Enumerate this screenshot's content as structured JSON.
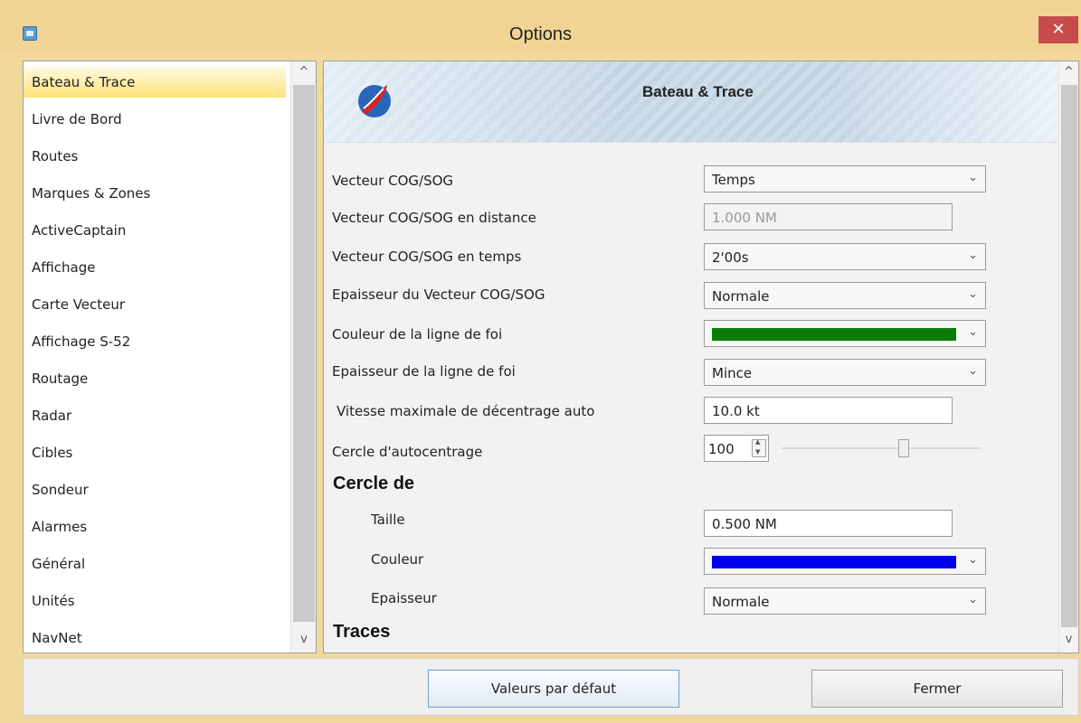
{
  "window": {
    "title": "Options",
    "close_label": "✕"
  },
  "sidebar": {
    "items": [
      {
        "label": "Bateau & Trace",
        "active": true
      },
      {
        "label": "Livre de Bord"
      },
      {
        "label": "Routes"
      },
      {
        "label": "Marques & Zones"
      },
      {
        "label": "ActiveCaptain"
      },
      {
        "label": "Affichage"
      },
      {
        "label": "Carte Vecteur"
      },
      {
        "label": "Affichage S-52"
      },
      {
        "label": "Routage"
      },
      {
        "label": "Radar"
      },
      {
        "label": "Cibles"
      },
      {
        "label": "Sondeur"
      },
      {
        "label": "Alarmes"
      },
      {
        "label": "Général"
      },
      {
        "label": "Unités"
      },
      {
        "label": "NavNet"
      }
    ]
  },
  "panel": {
    "title": "Bateau & Trace",
    "fields": [
      {
        "label": "Vecteur COG/SOG",
        "value": "Temps",
        "kind": "select"
      },
      {
        "label": "Vecteur COG/SOG en distance",
        "value": "1.000 NM",
        "kind": "input-disabled"
      },
      {
        "label": "Vecteur COG/SOG en temps",
        "value": "2'00s",
        "kind": "select"
      },
      {
        "label": "Epaisseur du Vecteur COG/SOG",
        "value": "Normale",
        "kind": "select"
      },
      {
        "label": "Couleur de la ligne de foi",
        "value": "#0a7d0a",
        "kind": "color"
      },
      {
        "label": "Epaisseur de la ligne de foi",
        "value": "Mince",
        "kind": "select"
      },
      {
        "label": "Vitesse maximale de décentrage auto",
        "value": "10.0 kt",
        "kind": "input"
      },
      {
        "label": "Cercle d'autocentrage",
        "value": "100",
        "kind": "spin-slider",
        "slider_fraction": 0.62
      }
    ],
    "circle_section": {
      "heading": "Cercle de",
      "fields": [
        {
          "label": "Taille",
          "value": "0.500 NM",
          "kind": "input"
        },
        {
          "label": "Couleur",
          "value": "#0000ee",
          "kind": "color"
        },
        {
          "label": "Epaisseur",
          "value": "Normale",
          "kind": "select"
        }
      ]
    },
    "traces_heading": "Traces"
  },
  "footer": {
    "defaults_button": "Valeurs par défaut",
    "close_button": "Fermer"
  },
  "icons": {
    "scroll_up": "▲",
    "scroll_down": "▼",
    "dropdown": "⌄",
    "up_caret": "^",
    "down_caret": "v"
  }
}
